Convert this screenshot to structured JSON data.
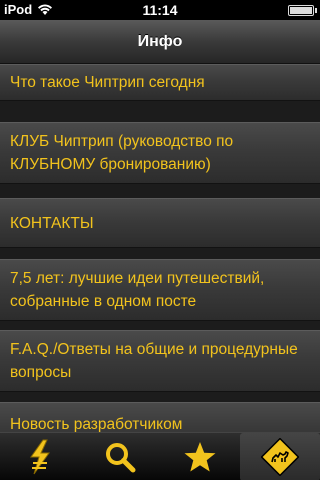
{
  "status": {
    "carrier": "iPod",
    "time": "11:14"
  },
  "nav": {
    "title": "Инфо"
  },
  "menu": {
    "items": [
      {
        "label": "Что такое Чиптрип сегодня"
      },
      {
        "label": "КЛУБ Чиптрип (руководство по КЛУБНОМУ бронированию)"
      },
      {
        "label": "КОНТАКТЫ"
      },
      {
        "label": "7,5 лет: лучшие идеи путешествий, собранные в одном посте"
      },
      {
        "label": "F.A.Q./Ответы на общие и процедурные вопросы"
      },
      {
        "label": "Новость разработчиком"
      }
    ]
  },
  "tabs": [
    {
      "icon": "lightning-logo-icon",
      "color": "#f2c31d"
    },
    {
      "icon": "search-icon",
      "color": "#f2c31d"
    },
    {
      "icon": "star-icon",
      "color": "#f2c31d"
    },
    {
      "icon": "camel-sign-icon",
      "color": "#f2c31d",
      "selected": true
    }
  ],
  "colors": {
    "accent": "#f2c31d",
    "background": "#1c1c1c"
  }
}
